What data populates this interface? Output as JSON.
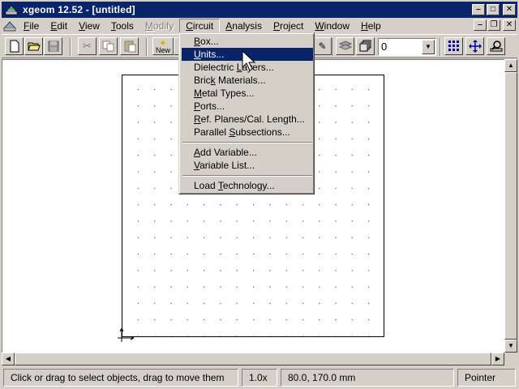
{
  "window": {
    "title": "xgeom 12.52 - [untitled]"
  },
  "menubar": {
    "items": [
      {
        "label": "File",
        "u": "F",
        "rest": "ile"
      },
      {
        "label": "Edit",
        "u": "E",
        "rest": "dit"
      },
      {
        "label": "View",
        "u": "V",
        "rest": "iew"
      },
      {
        "label": "Tools",
        "u": "T",
        "rest": "ools"
      },
      {
        "label": "Modify",
        "u": "M",
        "rest": "odify"
      },
      {
        "label": "Circuit",
        "u": "C",
        "rest": "ircuit"
      },
      {
        "label": "Analysis",
        "u": "A",
        "rest": "nalysis"
      },
      {
        "label": "Project",
        "u": "P",
        "rest": "roject"
      },
      {
        "label": "Window",
        "u": "W",
        "rest": "indow"
      },
      {
        "label": "Help",
        "u": "H",
        "rest": "elp"
      }
    ]
  },
  "toolbar": {
    "new_label": "New",
    "layer_value": "0"
  },
  "circuit_menu": {
    "items": [
      {
        "label": "Box...",
        "u": "B",
        "rest": "ox..."
      },
      {
        "label": "Units...",
        "u": "U",
        "rest": "nits..."
      },
      {
        "label": "Dielectric Layers...",
        "pre": "Dielectric ",
        "u": "L",
        "rest": "ayers..."
      },
      {
        "label": "Brick Materials...",
        "pre": "Bric",
        "u": "k",
        "rest": " Materials..."
      },
      {
        "label": "Metal Types...",
        "u": "M",
        "rest": "etal Types..."
      },
      {
        "label": "Ports...",
        "u": "P",
        "rest": "orts..."
      },
      {
        "label": "Ref. Planes/Cal. Length...",
        "u": "R",
        "rest": "ef. Planes/Cal. Length..."
      },
      {
        "label": "Parallel Subsections...",
        "pre": "Parallel ",
        "u": "S",
        "rest": "ubsections..."
      },
      {
        "label": "Add Variable...",
        "u": "A",
        "rest": "dd Variable..."
      },
      {
        "label": "Variable List...",
        "u": "V",
        "rest": "ariable List..."
      },
      {
        "label": "Load Technology...",
        "pre": "Load ",
        "u": "T",
        "rest": "echnology..."
      }
    ],
    "highlighted_index": 1
  },
  "statusbar": {
    "message": "Click or drag to select objects, drag to move them",
    "zoom": "1.0x",
    "coords": "80.0, 170.0 mm",
    "mode": "Pointer"
  },
  "colors": {
    "titlebar": "#0a246a",
    "highlight": "#0a246a",
    "chrome": "#d4d0c8"
  }
}
